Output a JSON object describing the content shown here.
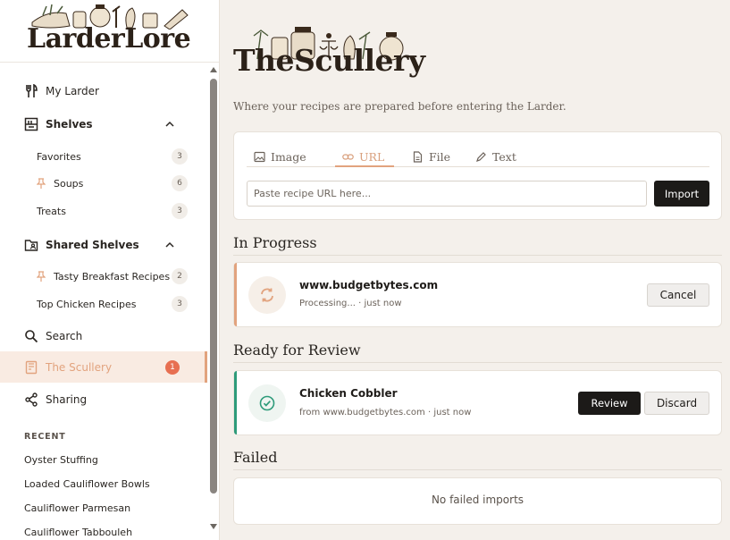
{
  "app": {
    "logo_text": "LarderLore"
  },
  "sidebar": {
    "my_larder": "My Larder",
    "shelves": {
      "label": "Shelves",
      "items": [
        {
          "label": "Favorites",
          "count": "3"
        },
        {
          "label": "Soups",
          "count": "6",
          "pinned": true
        },
        {
          "label": "Treats",
          "count": "3"
        }
      ]
    },
    "shared_shelves": {
      "label": "Shared Shelves",
      "items": [
        {
          "label": "Tasty Breakfast Recipes",
          "count": "2",
          "pinned": true
        },
        {
          "label": "Top Chicken Recipes",
          "count": "3"
        }
      ]
    },
    "search": "Search",
    "scullery": {
      "label": "The Scullery",
      "badge": "1"
    },
    "sharing": "Sharing",
    "recent": {
      "header": "RECENT",
      "items": [
        "Oyster Stuffing",
        "Loaded Cauliflower Bowls",
        "Cauliflower Parmesan",
        "Cauliflower Tabbouleh"
      ]
    }
  },
  "main": {
    "title": "TheScullery",
    "tagline": "Where your recipes are prepared before entering the Larder.",
    "import_card": {
      "tabs": [
        "Image",
        "URL",
        "File",
        "Text"
      ],
      "active_tab": "URL",
      "url_placeholder": "Paste recipe URL here...",
      "url_value": "",
      "import_label": "Import"
    },
    "in_progress": {
      "header": "In Progress",
      "item": {
        "title": "www.budgetbytes.com",
        "status": "Processing... · just now",
        "cancel_label": "Cancel"
      }
    },
    "ready": {
      "header": "Ready for Review",
      "item": {
        "title": "Chicken Cobbler",
        "source": "from www.budgetbytes.com · just now",
        "review_label": "Review",
        "discard_label": "Discard"
      }
    },
    "failed": {
      "header": "Failed",
      "empty": "No failed imports"
    }
  },
  "colors": {
    "accent": "#e2a37e",
    "success": "#2e9b7a",
    "badge": "#e76f51",
    "dark_button": "#1c1a18"
  },
  "icons": [
    "fork-knife-icon",
    "shelf-icon",
    "chevron-up-icon",
    "pin-icon",
    "folder-user-icon",
    "search-icon",
    "scullery-icon",
    "share-icon",
    "image-icon",
    "link-icon",
    "file-icon",
    "pencil-icon",
    "sync-icon",
    "check-circle-icon"
  ]
}
